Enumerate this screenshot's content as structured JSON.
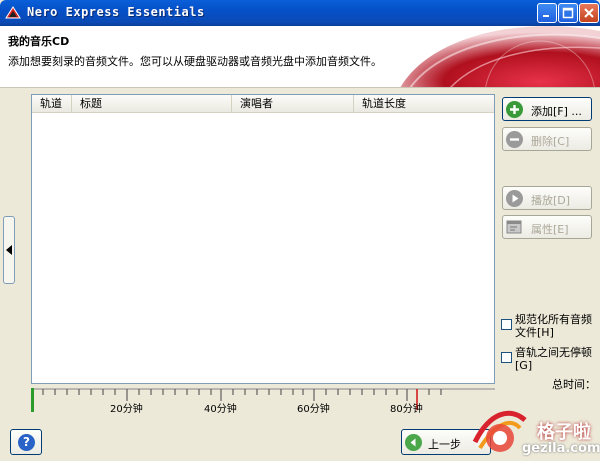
{
  "window": {
    "title": "Nero Express Essentials"
  },
  "header": {
    "title": "我的音乐CD",
    "subtitle": "添加想要刻录的音频文件。您可以从硬盘驱动器或音频光盘中添加音频文件。"
  },
  "table": {
    "columns": [
      "轨道",
      "标题",
      "演唱者",
      "轨道长度"
    ]
  },
  "timeline": {
    "labels": [
      "20分钟",
      "40分钟",
      "60分钟",
      "80分钟"
    ]
  },
  "actions": {
    "add": "添加[F] ...",
    "delete": "删除[C]",
    "play": "播放[D]",
    "properties": "属性[E]"
  },
  "options": {
    "normalize": {
      "line1": "规范化所有音频",
      "line2": "文件[H]"
    },
    "no_pause": {
      "line1": "音轨之间无停顿",
      "line2": "[G]"
    },
    "total_time_label": "总时间："
  },
  "footer": {
    "help": "?",
    "back": "上一步"
  },
  "watermark": {
    "text": "格子啦",
    "url": "gezila.com"
  },
  "colors": {
    "titlebar": "#0550c8",
    "accent_red": "#c0182a",
    "add_icon": "#3a9a3a"
  }
}
